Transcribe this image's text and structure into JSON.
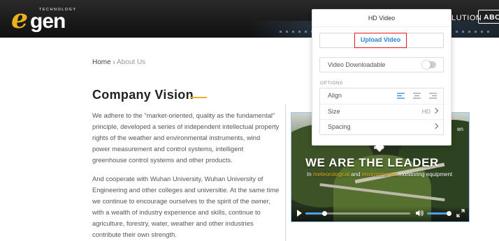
{
  "header": {
    "logo_mark": "e",
    "logo_name": "gen",
    "logo_tagline": "TECHNOLOGY",
    "nav_solution": "LUTION",
    "nav_about": "ABOU"
  },
  "breadcrumb": {
    "home": "Home",
    "separator": "›",
    "current": "About Us"
  },
  "page": {
    "title": "Company Vision",
    "accent_color": "#e6b223",
    "paragraph1": "We adhere to the \"market-oriented, quality as the fundamental\" principle, developed a series of independent intellectual property rights of the weather and environmental instruments, wind power measurement and control systems, intelligent greenhouse control systems and other products.",
    "paragraph2": "And cooperate with Wuhan University, Wuhan University of Engineering and other colleges and universitie. At the same time we continue to encourage ourselves to the spirit of the owner, with a wealth of industry experience and skills, continue to agriculture, forestry, water, weather and other industries contribute their own strength."
  },
  "video": {
    "corner_text": "en",
    "headline": "WE ARE THE LEADER",
    "sub_prefix": "In ",
    "sub_hl1": "meteorological",
    "sub_mid": " and ",
    "sub_hl2": "environmental",
    "sub_suffix": " monitoring equipment",
    "progress": 0.18,
    "volume": 0.9,
    "icons": [
      "play-icon",
      "volume-icon",
      "fullscreen-icon"
    ]
  },
  "panel": {
    "title": "HD Video",
    "upload_label": "Upload Video",
    "downloadable_label": "Video Downloadable",
    "downloadable_on": false,
    "options_heading": "OPTIONS",
    "align_label": "Align",
    "align_selected": "left",
    "size_label": "Size",
    "size_value": "HD",
    "spacing_label": "Spacing",
    "accent_color": "#2b86d6",
    "highlight_color": "#e02020"
  }
}
